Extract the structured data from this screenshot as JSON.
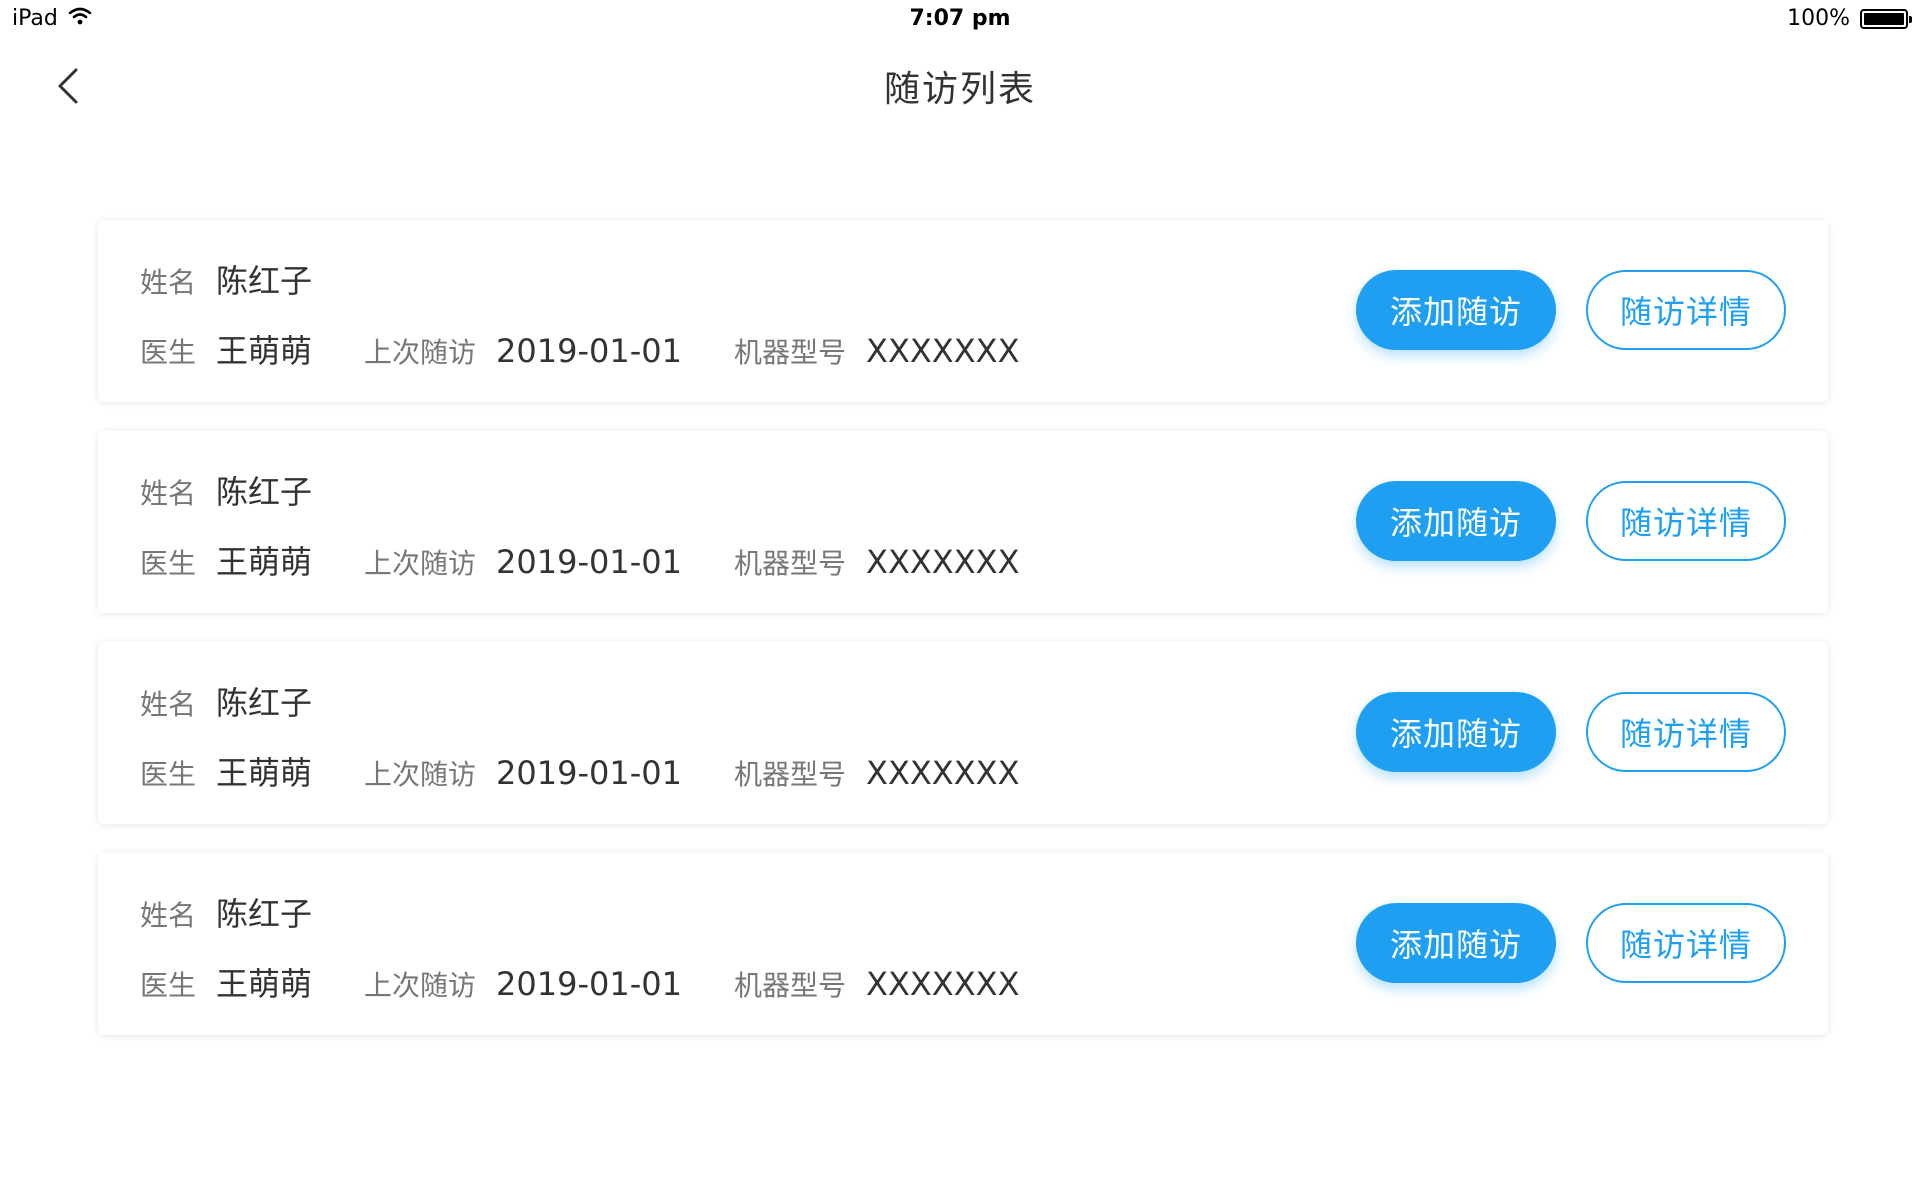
{
  "status_bar": {
    "device": "iPad",
    "time": "7:07 pm",
    "battery": "100%"
  },
  "nav": {
    "title": "随访列表",
    "back_icon": "chevron-left-icon"
  },
  "labels": {
    "name": "姓名",
    "doctor": "医生",
    "last_visit": "上次随访",
    "machine_model": "机器型号",
    "add_button": "添加随访",
    "detail_button": "随访详情"
  },
  "colors": {
    "accent": "#1e9ff2"
  },
  "records": [
    {
      "name": "陈红子",
      "doctor": "王萌萌",
      "last_visit": "2019-01-01",
      "machine_model": "XXXXXXX"
    },
    {
      "name": "陈红子",
      "doctor": "王萌萌",
      "last_visit": "2019-01-01",
      "machine_model": "XXXXXXX"
    },
    {
      "name": "陈红子",
      "doctor": "王萌萌",
      "last_visit": "2019-01-01",
      "machine_model": "XXXXXXX"
    },
    {
      "name": "陈红子",
      "doctor": "王萌萌",
      "last_visit": "2019-01-01",
      "machine_model": "XXXXXXX"
    }
  ]
}
